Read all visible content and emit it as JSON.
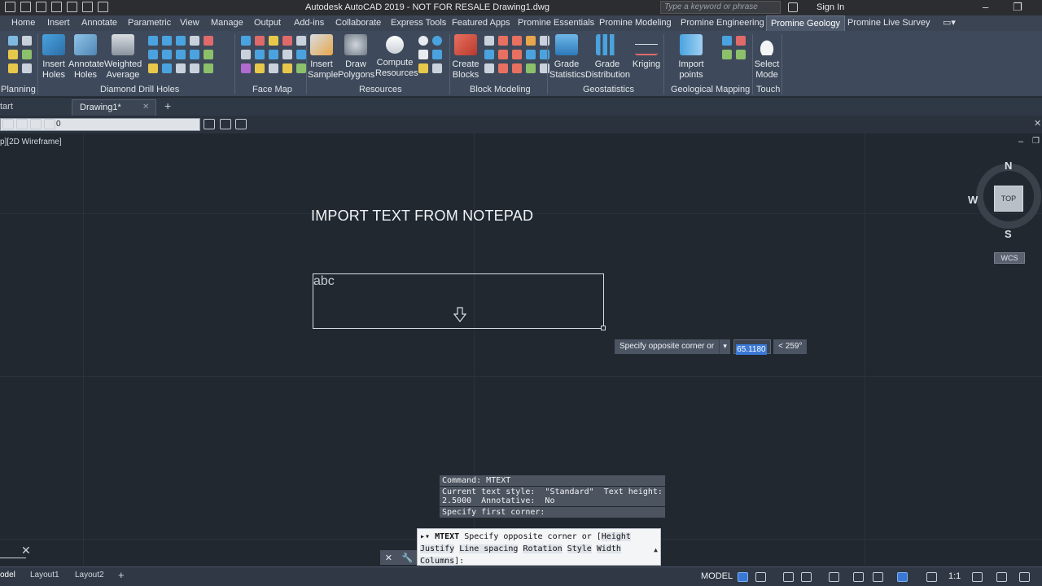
{
  "window": {
    "title": "Autodesk AutoCAD 2019 - NOT FOR RESALE    Drawing1.dwg",
    "search_placeholder": "Type a keyword or phrase",
    "sign_in": "Sign In"
  },
  "ribbon_tabs": [
    "Home",
    "Insert",
    "Annotate",
    "Parametric",
    "View",
    "Manage",
    "Output",
    "Add-ins",
    "Collaborate",
    "Express Tools",
    "Featured Apps",
    "Promine Essentials",
    "Promine Modeling",
    "Promine Engineering",
    "Promine Geology",
    "Promine Live Survey"
  ],
  "active_tab": "Promine Geology",
  "ribbon": {
    "buttons": {
      "insert_holes": [
        "Insert",
        "Holes"
      ],
      "annotate_holes": [
        "Annotate",
        "Holes"
      ],
      "weighted_average": [
        "Weighted",
        "Average"
      ],
      "insert_sample": [
        "Insert",
        "Sample"
      ],
      "draw_polygons": [
        "Draw",
        "Polygons"
      ],
      "compute_resources": [
        "Compute",
        "Resources"
      ],
      "create_blocks": [
        "Create",
        "Blocks"
      ],
      "grade_statistics": [
        "Grade",
        "Statistics"
      ],
      "grade_distribution": [
        "Grade",
        "Distribution"
      ],
      "kriging": [
        "Kriging"
      ],
      "import_points": [
        "Import points"
      ],
      "select_mode": [
        "Select",
        "Mode"
      ]
    },
    "panels": {
      "planning": "Planning",
      "diamond_drill_holes": "Diamond Drill Holes",
      "face_map": "Face Map",
      "resources": "Resources",
      "block_modeling": "Block Modeling",
      "geostatistics": "Geostatistics",
      "geological_mapping": "Geological Mapping",
      "touch": "Touch"
    }
  },
  "file_tabs": {
    "start": "tart",
    "drawing": "Drawing1*"
  },
  "layer": {
    "current": "0"
  },
  "viewport": {
    "label": "p][2D Wireframe]"
  },
  "drawing": {
    "title_text": "IMPORT TEXT FROM NOTEPAD",
    "mtext_sample": "abc"
  },
  "tooltip": {
    "prompt": "Specify opposite corner or",
    "value": "65.1180",
    "angle": "< 259°"
  },
  "viewcube": {
    "top": "TOP",
    "north": "N",
    "south": "S",
    "west": "W",
    "wcs": "WCS"
  },
  "command": {
    "history": [
      "Command: MTEXT",
      "Current text style:  \"Standard\"  Text height:\n2.5000  Annotative:  No",
      "Specify first corner:"
    ],
    "current_cmd": "MTEXT",
    "prompt_pre": "Specify opposite corner or [",
    "options": [
      "Height",
      "Justify",
      "Line spacing",
      "Rotation",
      "Style",
      "Width",
      "Columns"
    ],
    "prompt_post": "]:"
  },
  "layout_tabs": [
    "odel",
    "Layout1",
    "Layout2"
  ],
  "status": {
    "model": "MODEL",
    "scale": "1:1"
  },
  "colors": {
    "canvas": "#212830",
    "ribbon": "#3e4a5b",
    "accent": "#3a78d6"
  }
}
